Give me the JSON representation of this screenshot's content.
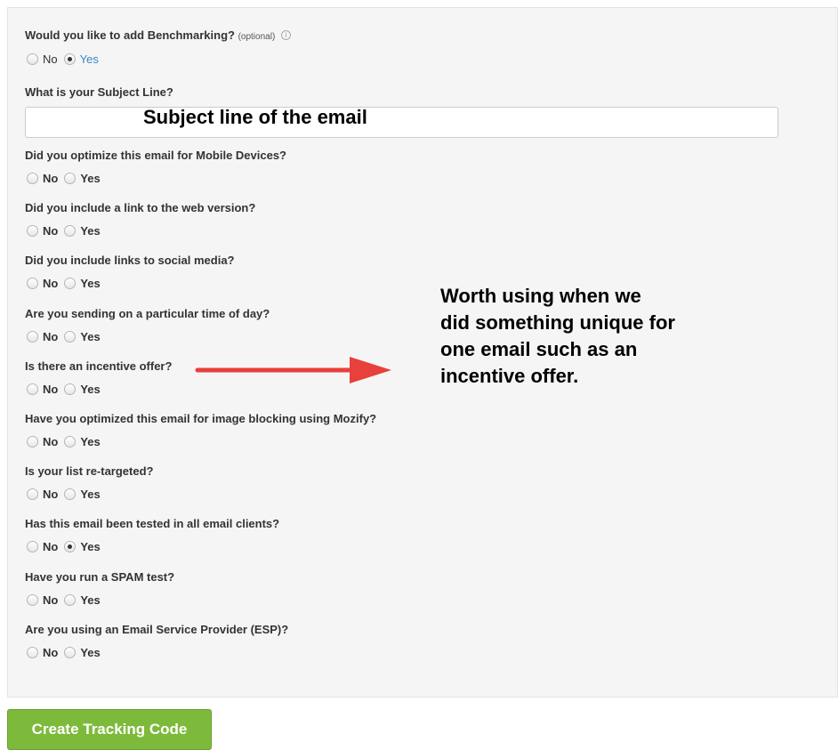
{
  "benchmark": {
    "question": "Would you like to add Benchmarking?",
    "optional": "(optional)",
    "info_icon": "info-icon",
    "no": "No",
    "yes": "Yes",
    "selected": "Yes"
  },
  "subject": {
    "question": "What is your Subject Line?",
    "value": ""
  },
  "questions": [
    {
      "text": "Did you optimize this email for Mobile Devices?",
      "no": "No",
      "yes": "Yes",
      "selected": ""
    },
    {
      "text": "Did you include a link to the web version?",
      "no": "No",
      "yes": "Yes",
      "selected": ""
    },
    {
      "text": "Did you include links to social media?",
      "no": "No",
      "yes": "Yes",
      "selected": ""
    },
    {
      "text": "Are you sending on a particular time of day?",
      "no": "No",
      "yes": "Yes",
      "selected": ""
    },
    {
      "text": "Is there an incentive offer?",
      "no": "No",
      "yes": "Yes",
      "selected": ""
    },
    {
      "text": "Have you optimized this email for image blocking using Mozify?",
      "no": "No",
      "yes": "Yes",
      "selected": ""
    },
    {
      "text": "Is your list re-targeted?",
      "no": "No",
      "yes": "Yes",
      "selected": ""
    },
    {
      "text": "Has this email been tested in all email clients?",
      "no": "No",
      "yes": "Yes",
      "selected": "Yes"
    },
    {
      "text": "Have you run a SPAM test?",
      "no": "No",
      "yes": "Yes",
      "selected": ""
    },
    {
      "text": "Are you using an Email Service Provider (ESP)?",
      "no": "No",
      "yes": "Yes",
      "selected": ""
    }
  ],
  "annotations": {
    "subject_overlay": "Subject line of the email",
    "note_lines": [
      "Worth using when we",
      "did something unique for",
      "one email such as an",
      "incentive offer."
    ],
    "arrow_color": "#e8403a"
  },
  "button": {
    "label": "Create Tracking Code",
    "color": "#7dba3c"
  }
}
